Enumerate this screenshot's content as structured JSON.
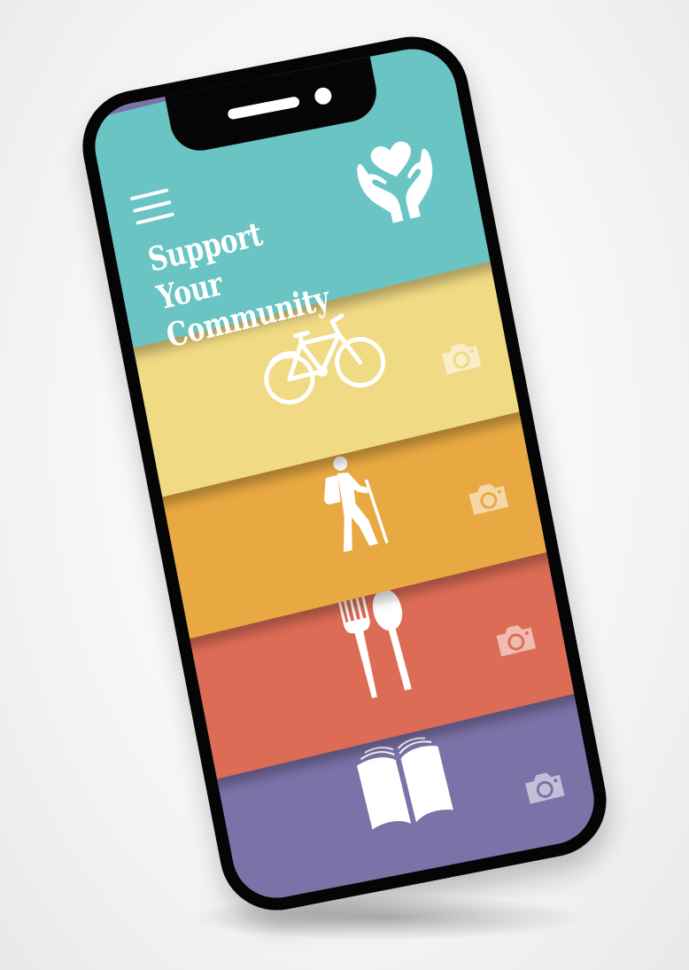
{
  "app": {
    "title_line1": "Support Your",
    "title_line2": "Community",
    "header_icon": "heart-in-hands-icon",
    "menu_icon": "hamburger-menu-icon"
  },
  "categories": [
    {
      "icon": "bicycle-icon",
      "action_icon": "camera-icon",
      "color": "#f1da84"
    },
    {
      "icon": "hiker-icon",
      "action_icon": "camera-icon",
      "color": "#e9a942"
    },
    {
      "icon": "fork-spoon-icon",
      "action_icon": "camera-icon",
      "color": "#dd6c56"
    },
    {
      "icon": "open-book-icon",
      "action_icon": "camera-icon",
      "color": "#7b72a8"
    }
  ],
  "colors": {
    "header": "#69c4c3",
    "phone_frame": "#050505",
    "icon": "#ffffff"
  }
}
